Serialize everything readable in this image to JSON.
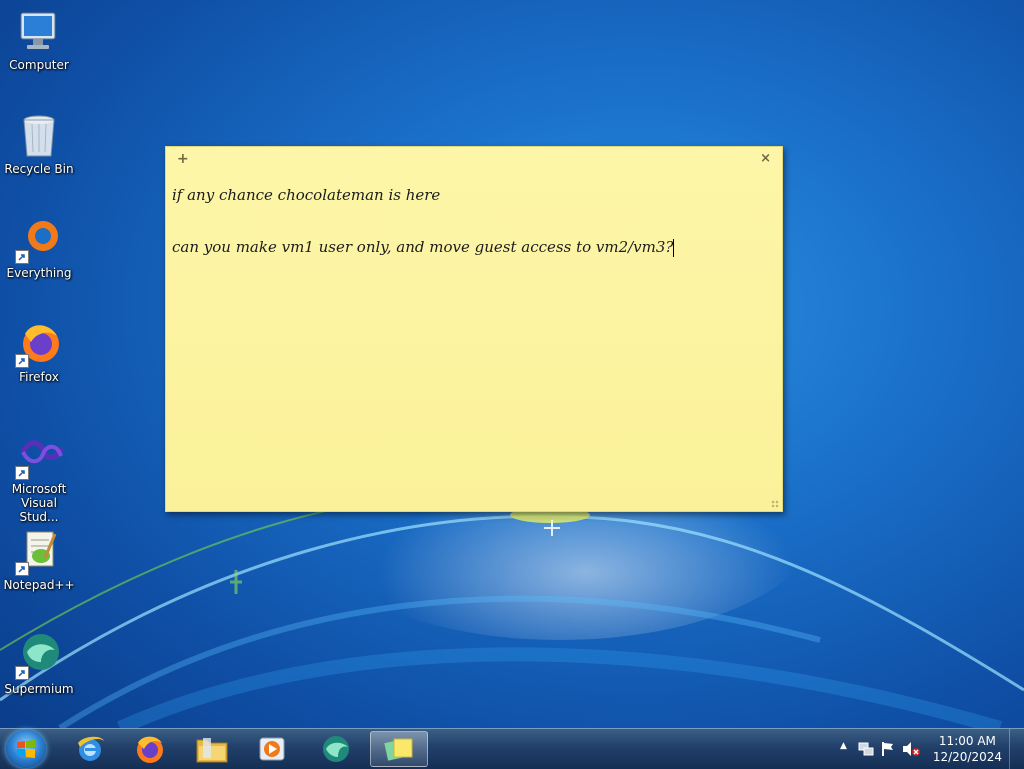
{
  "desktop": {
    "icons": [
      {
        "label": "Computer",
        "icon": "computer-icon"
      },
      {
        "label": "Recycle Bin",
        "icon": "recycle-bin-icon"
      },
      {
        "label": "Everything",
        "icon": "everything-icon"
      },
      {
        "label": "Firefox",
        "icon": "firefox-icon"
      },
      {
        "label": "Microsoft\nVisual Stud...",
        "label_line1": "Microsoft",
        "label_line2": "Visual Stud...",
        "icon": "visual-studio-icon"
      },
      {
        "label": "Notepad++",
        "icon": "notepadpp-icon"
      },
      {
        "label": "Supermium",
        "icon": "supermium-icon"
      }
    ]
  },
  "sticky_note": {
    "add_glyph": "+",
    "close_glyph": "×",
    "lines": [
      "if any chance chocolateman is here",
      "",
      "can you make vm1 user only, and move guest access to vm2/vm3?"
    ],
    "background": "#fbf19a"
  },
  "taskbar": {
    "pinned": [
      "internet-explorer-icon",
      "firefox-icon",
      "file-explorer-icon",
      "media-player-icon",
      "supermium-icon",
      "sticky-notes-icon"
    ],
    "active_item": "sticky-notes-icon",
    "tray": {
      "show_hidden_glyph": "▲",
      "time": "11:00 AM",
      "date": "12/20/2024"
    }
  }
}
